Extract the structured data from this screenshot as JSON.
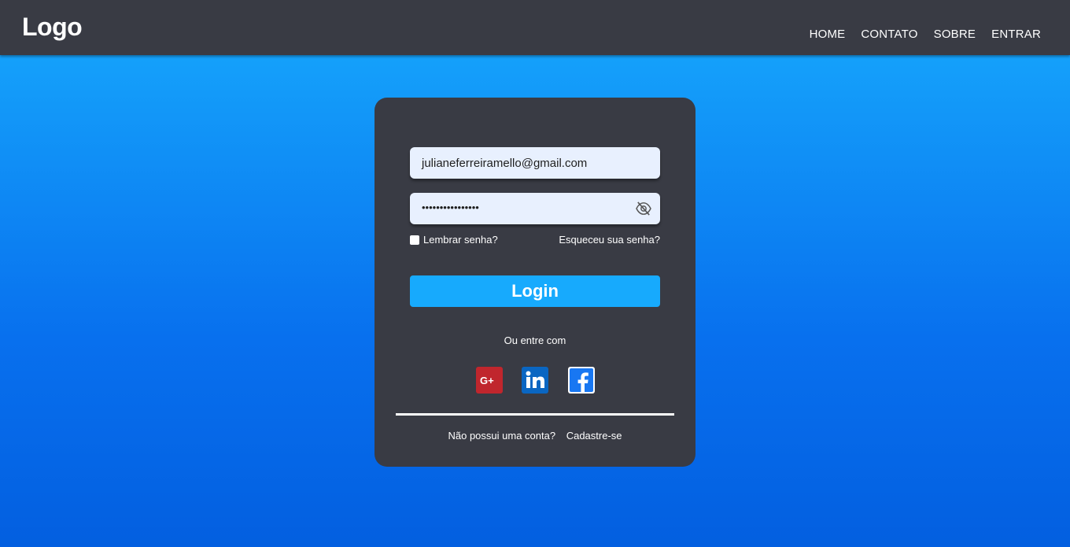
{
  "header": {
    "logo": "Logo",
    "nav": [
      "HOME",
      "CONTATO",
      "SOBRE",
      "ENTRAR"
    ]
  },
  "login": {
    "email_value": "julianeferreiramello@gmail.com",
    "password_mask": "••••••••••••••••",
    "remember_label": "Lembrar senha?",
    "forgot_label": "Esqueceu sua senha?",
    "login_button": "Login",
    "or_text": "Ou entre com",
    "signup_prompt": "Não possui uma conta?",
    "signup_link": "Cadastre-se"
  },
  "icons": {
    "eye": "eye-slash-icon",
    "google": "google-plus-icon",
    "linkedin": "linkedin-icon",
    "facebook": "facebook-icon"
  },
  "colors": {
    "header_bg": "#393b44",
    "card_bg": "#393b44",
    "accent": "#17aafd",
    "input_bg": "#e8f0fe",
    "google": "#c0262d",
    "linkedin": "#0a66c2",
    "facebook": "#1877f2"
  }
}
